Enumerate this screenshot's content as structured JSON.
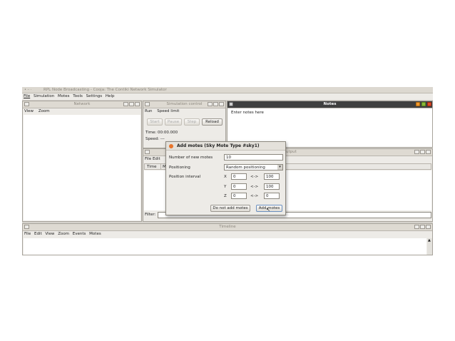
{
  "app": {
    "window_title": "RPL Node Broadcasting - Cooja: The Contiki Network Simulator",
    "menu": [
      "File",
      "Simulation",
      "Motes",
      "Tools",
      "Settings",
      "Help"
    ]
  },
  "network": {
    "title": "Network",
    "menu": [
      "View",
      "Zoom"
    ]
  },
  "sim_control": {
    "title": "Simulation control",
    "menu": [
      "Run",
      "Speed limit"
    ],
    "buttons": {
      "start": "Start",
      "pause": "Pause",
      "step": "Step",
      "reload": "Reload"
    },
    "time": "Time: 00:00.000",
    "speed": "Speed: ---"
  },
  "notes": {
    "title": "Notes",
    "text": "Enter notes here"
  },
  "mote_output": {
    "title_fragment": "utput",
    "menu_fragment": "File  Edit",
    "col_time": "Time",
    "col_mote": "Mo",
    "filter_label": "Filter:"
  },
  "timeline": {
    "title": "Timeline",
    "menu": [
      "File",
      "Edit",
      "View",
      "Zoom",
      "Events",
      "Motes"
    ]
  },
  "dialog": {
    "title": "Add motes (Sky Mote Type #sky1)",
    "num_label": "Number of new motes",
    "num_value": "10",
    "positioning_label": "Positioning",
    "positioning_value": "Random positioning",
    "interval_label": "Position interval",
    "x": {
      "label": "X",
      "min": "0",
      "max": "100"
    },
    "y": {
      "label": "Y",
      "min": "0",
      "max": "100"
    },
    "z": {
      "label": "Z",
      "min": "0",
      "max": "0"
    },
    "arrow": "<->",
    "cancel_button": "Do not add motes",
    "add_button": "Add motes"
  }
}
